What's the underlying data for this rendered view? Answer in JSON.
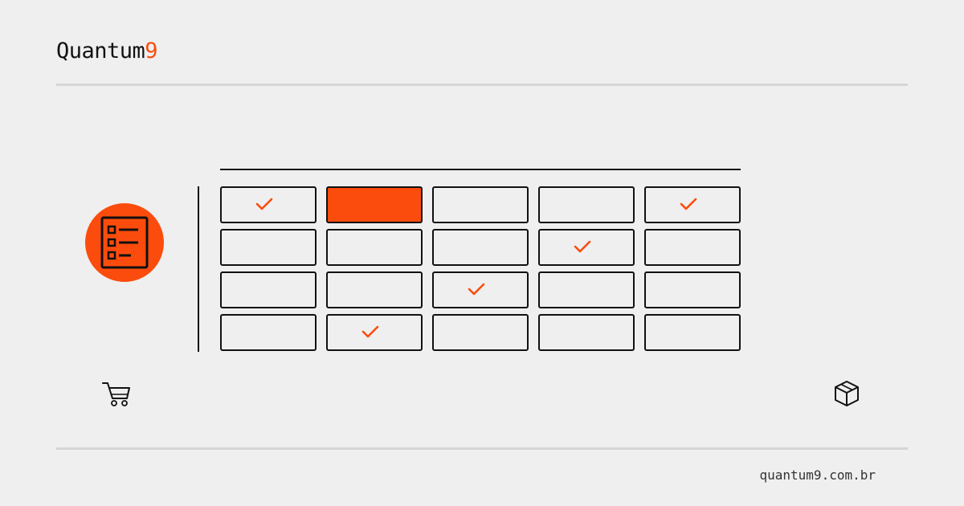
{
  "brand": {
    "name_text": "Quantum",
    "name_accent": "9",
    "accent_color": "#fc4c0d"
  },
  "footer": {
    "url": "quantum9.com.br"
  },
  "grid": {
    "rows": 4,
    "cols": 5,
    "checked": [
      [
        0,
        0
      ],
      [
        0,
        4
      ],
      [
        1,
        3
      ],
      [
        2,
        2
      ],
      [
        3,
        1
      ]
    ],
    "highlighted": [
      [
        0,
        1
      ]
    ]
  },
  "icons": {
    "badge": "checklist-icon",
    "left": "cart-icon",
    "right": "package-icon"
  }
}
